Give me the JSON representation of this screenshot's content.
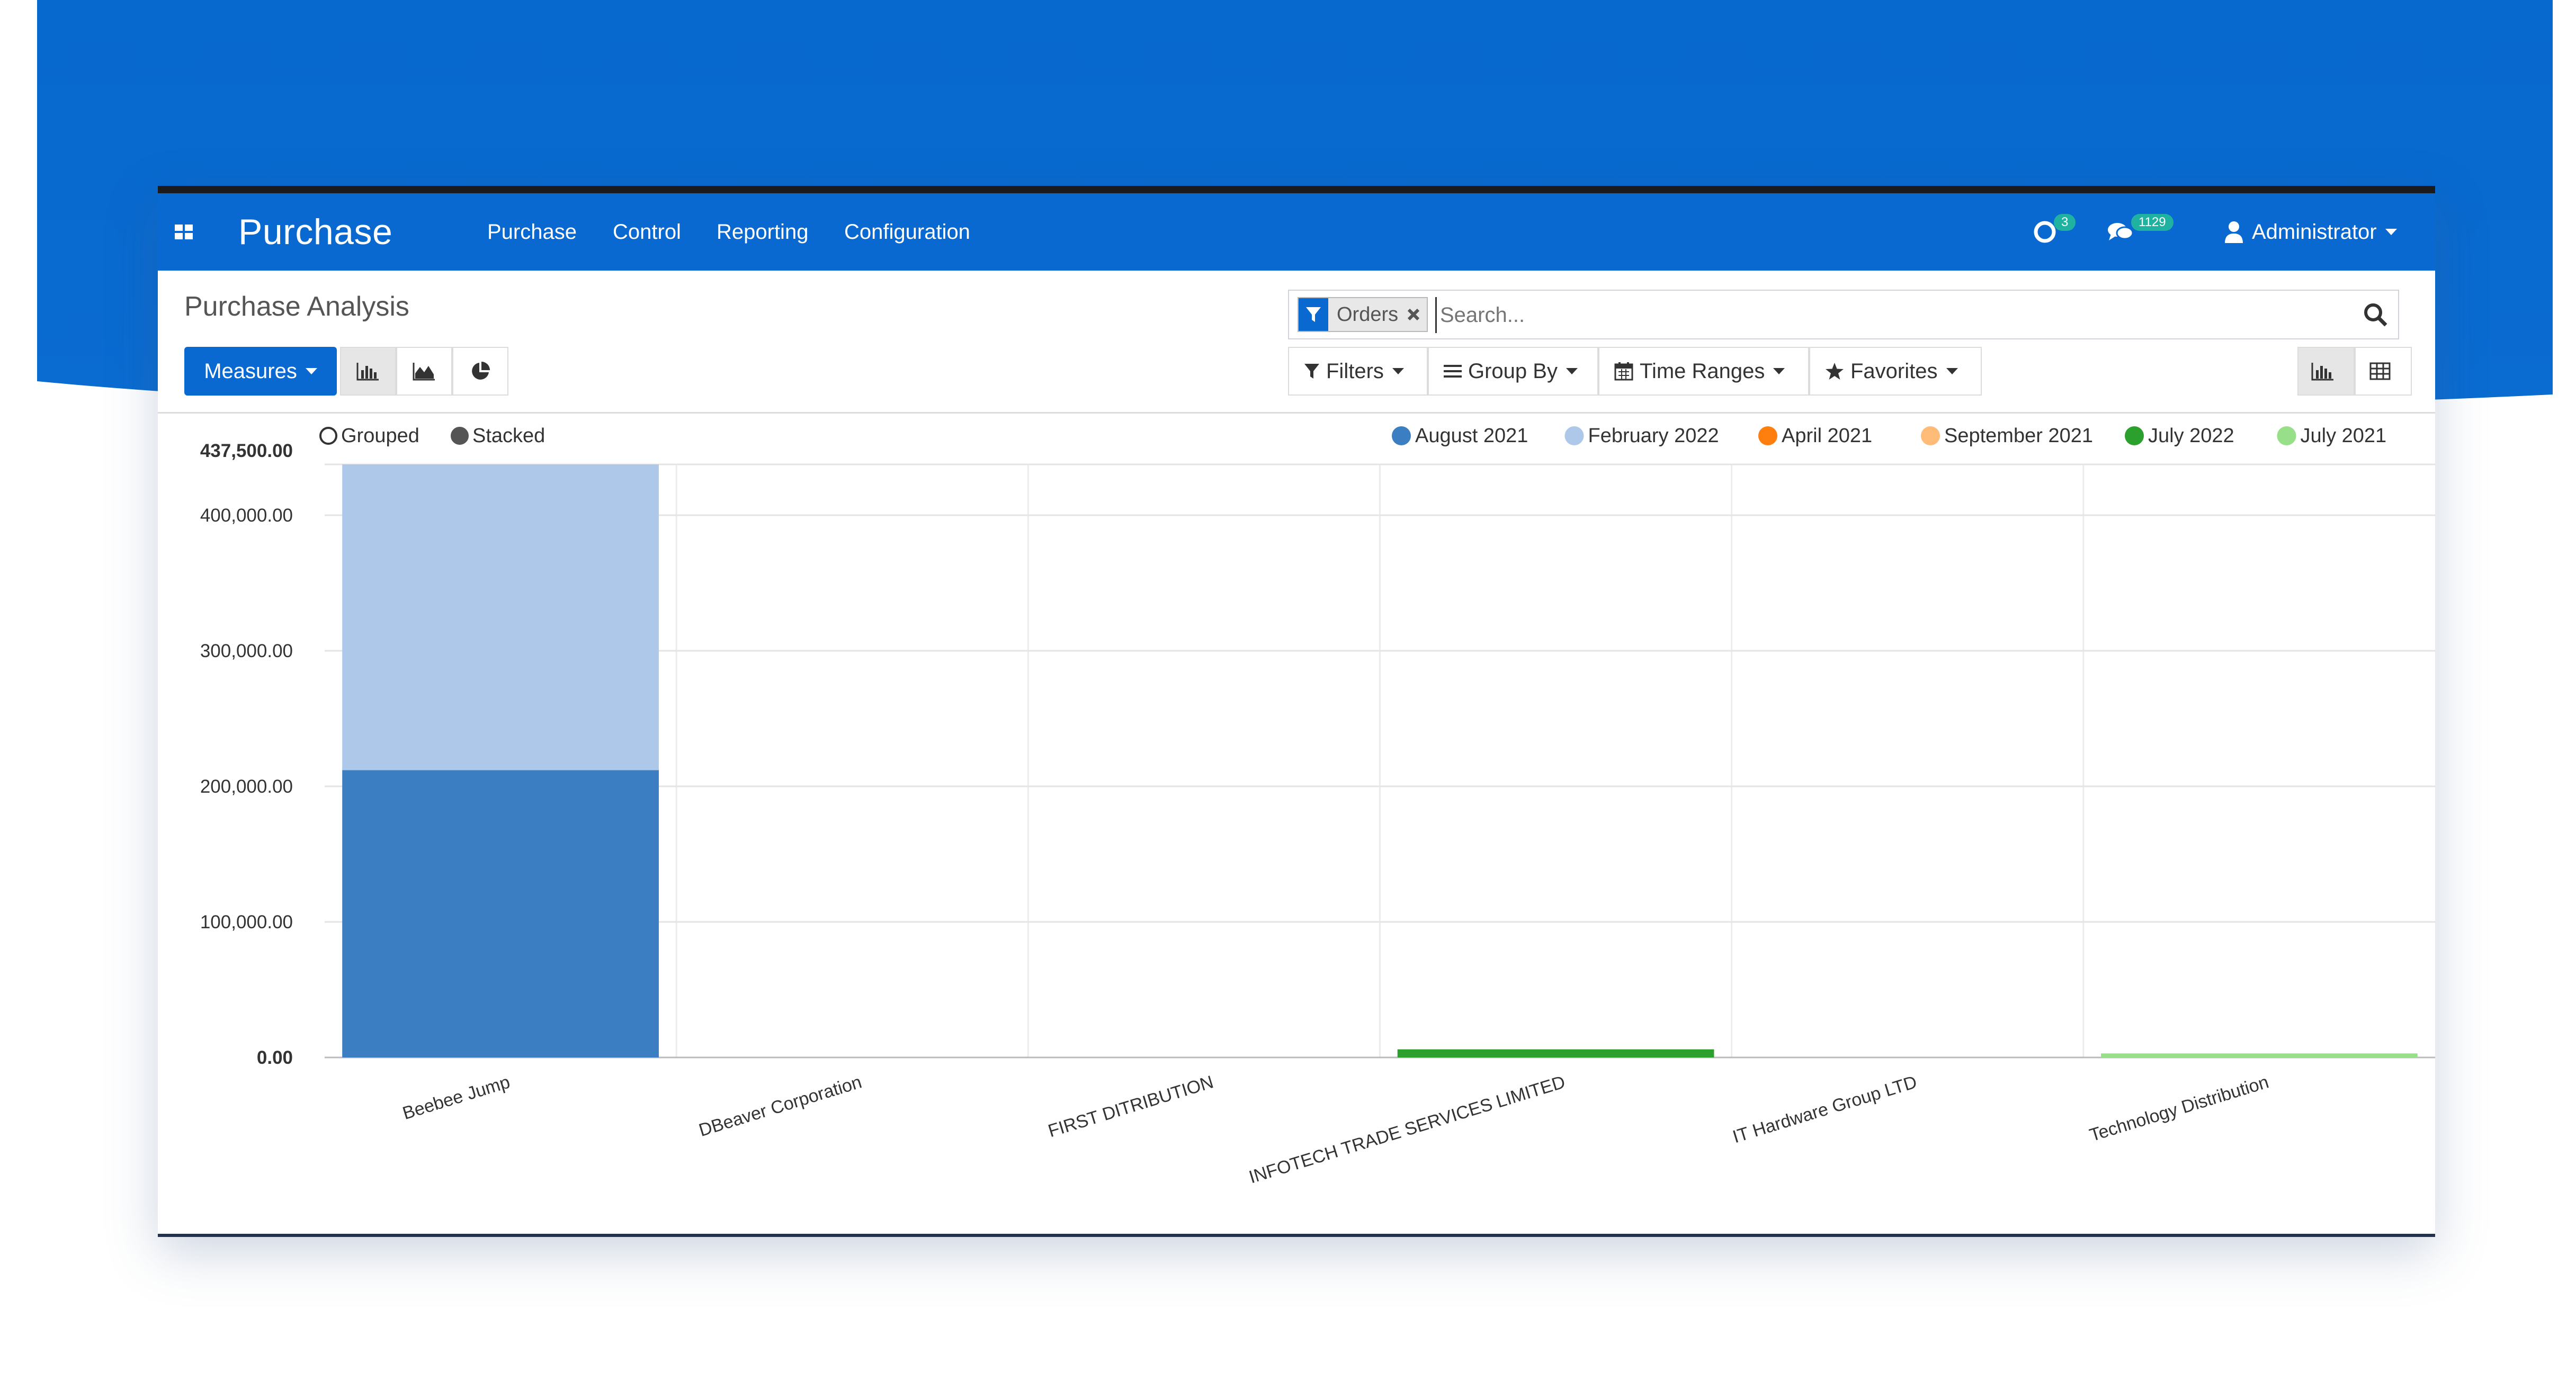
{
  "navbar": {
    "app_title": "Purchase",
    "menu": [
      {
        "label": "Purchase"
      },
      {
        "label": "Control"
      },
      {
        "label": "Reporting"
      },
      {
        "label": "Configuration"
      }
    ],
    "activity_count": "3",
    "message_count": "1129",
    "user_name": "Administrator"
  },
  "control_panel": {
    "breadcrumb": "Purchase Analysis",
    "measures_label": "Measures",
    "search": {
      "facet_label": "Orders",
      "placeholder": "Search..."
    },
    "filters_label": "Filters",
    "group_by_label": "Group By",
    "time_ranges_label": "Time Ranges",
    "favorites_label": "Favorites"
  },
  "colors": {
    "brand": "#0a69d0",
    "badge": "#20b2a0"
  },
  "icons": [
    "apps-icon",
    "bar-chart-icon",
    "area-chart-icon",
    "pie-chart-icon",
    "filter-icon",
    "close-icon",
    "search-icon",
    "list-icon",
    "calendar-icon",
    "star-icon",
    "table-icon",
    "clock-icon",
    "chat-icon",
    "user-icon"
  ],
  "chart_data": {
    "type": "bar",
    "mode_options": [
      {
        "label": "Grouped",
        "selected": false
      },
      {
        "label": "Stacked",
        "selected": true
      }
    ],
    "categories": [
      "Beebee Jump",
      "DBeaver Corporation",
      "FIRST DITRIBUTION",
      "INFOTECH TRADE SERVICES LIMITED",
      "IT Hardware Group LTD",
      "Technology Distribution"
    ],
    "series": [
      {
        "name": "August 2021",
        "color": "#3b7ec2",
        "values": [
          212000,
          0,
          0,
          0,
          0,
          0
        ]
      },
      {
        "name": "February 2022",
        "color": "#aec8ea",
        "values": [
          225500,
          0,
          0,
          0,
          0,
          0
        ]
      },
      {
        "name": "April 2021",
        "color": "#ff7f0e",
        "values": [
          0,
          0,
          0,
          0,
          0,
          0
        ]
      },
      {
        "name": "September 2021",
        "color": "#ffbb78",
        "values": [
          0,
          0,
          0,
          0,
          0,
          0
        ]
      },
      {
        "name": "July 2022",
        "color": "#2ca02c",
        "values": [
          0,
          0,
          0,
          6000,
          0,
          0
        ]
      },
      {
        "name": "July 2021",
        "color": "#98df8a",
        "values": [
          0,
          0,
          0,
          0,
          0,
          3000
        ]
      }
    ],
    "yticks": [
      "0.00",
      "100,000.00",
      "200,000.00",
      "300,000.00",
      "400,000.00",
      "437,500.00"
    ],
    "ylim": [
      0,
      437500
    ],
    "grid": true,
    "legend_position": "top-right"
  }
}
